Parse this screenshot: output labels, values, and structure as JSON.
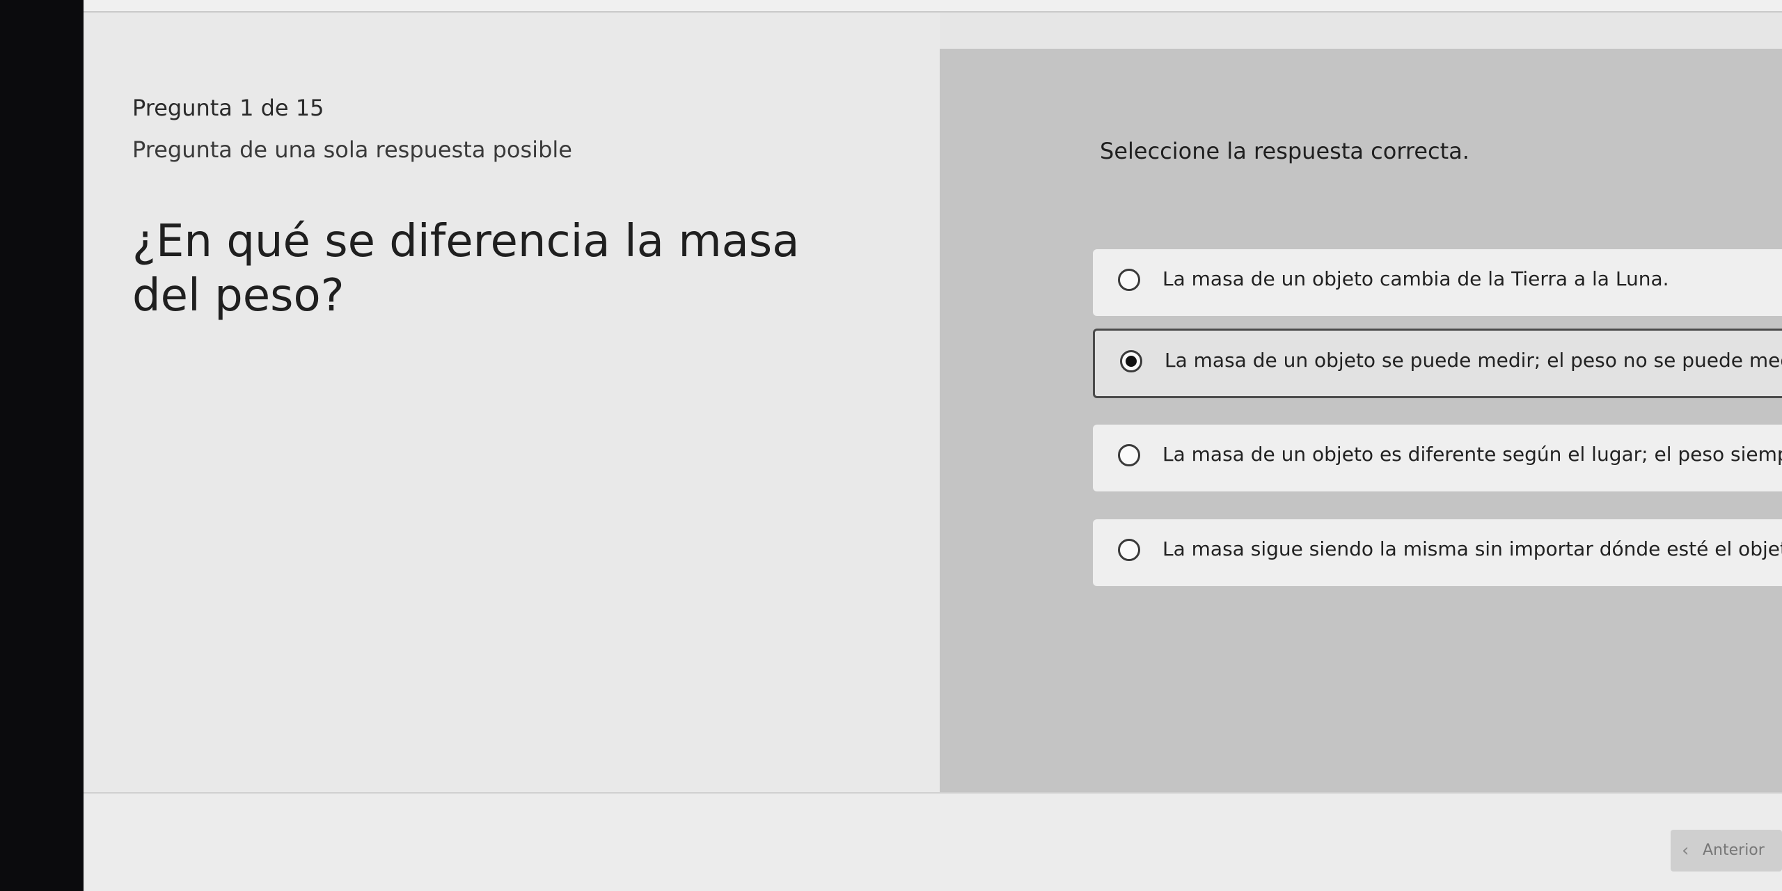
{
  "question": {
    "number": "Pregunta 1 de 15",
    "type": "Pregunta de una sola respuesta posible",
    "text": "¿En qué se diferencia la masa del peso?"
  },
  "answers": {
    "instruction": "Seleccione la respuesta correcta.",
    "options": [
      {
        "label": "La masa de un objeto cambia de la Tierra a la Luna.",
        "selected": false
      },
      {
        "label": "La masa de un objeto se puede medir; el peso no se puede medir.",
        "selected": true
      },
      {
        "label": "La masa de un objeto es diferente según el lugar; el peso siempre es el m",
        "selected": false
      },
      {
        "label": "La masa sigue siendo la misma sin importar dónde esté el objeto.",
        "selected": false
      }
    ]
  },
  "navigation": {
    "prev_label": "Anterior",
    "prev_icon": "chevron-left-icon"
  }
}
